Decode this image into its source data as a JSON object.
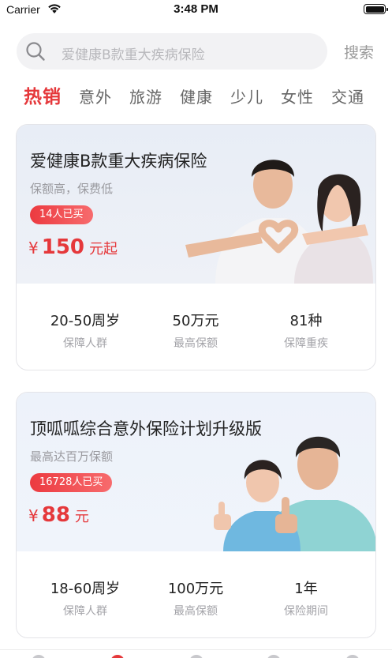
{
  "status_bar": {
    "carrier": "Carrier",
    "time": "3:48 PM"
  },
  "search": {
    "placeholder": "爱健康B款重大疾病保险",
    "button_label": "搜索"
  },
  "categories": [
    {
      "label": "热销",
      "active": true
    },
    {
      "label": "意外",
      "active": false
    },
    {
      "label": "旅游",
      "active": false
    },
    {
      "label": "健康",
      "active": false
    },
    {
      "label": "少儿",
      "active": false
    },
    {
      "label": "女性",
      "active": false
    },
    {
      "label": "交通",
      "active": false
    }
  ],
  "products": [
    {
      "title": "爱健康B款重大疾病保险",
      "subtitle": "保额高，保费低",
      "buyers": "14人已买",
      "price_currency": "¥",
      "price_value": "150",
      "price_suffix": "元起",
      "stats": [
        {
          "value": "20-50周岁",
          "label": "保障人群"
        },
        {
          "value": "50万元",
          "label": "最高保额"
        },
        {
          "value": "81种",
          "label": "保障重疾"
        }
      ]
    },
    {
      "title": "顶呱呱综合意外保险计划升级版",
      "subtitle": "最高达百万保额",
      "buyers": "16728人已买",
      "price_currency": "¥",
      "price_value": "88",
      "price_suffix": "元",
      "stats": [
        {
          "value": "18-60周岁",
          "label": "保障人群"
        },
        {
          "value": "100万元",
          "label": "最高保额"
        },
        {
          "value": "1年",
          "label": "保险期间"
        }
      ]
    }
  ],
  "colors": {
    "accent": "#e5383b",
    "card_header_bg": "#eaeef6",
    "muted_text": "#9a9a9f"
  }
}
